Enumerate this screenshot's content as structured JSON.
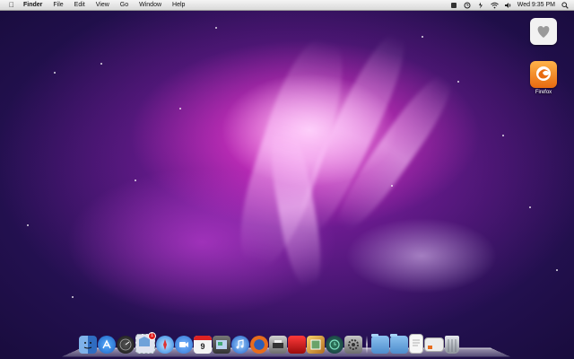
{
  "menubar": {
    "app_name": "Finder",
    "items": [
      "File",
      "Edit",
      "View",
      "Go",
      "Window",
      "Help"
    ],
    "clock": "Wed 9:35 PM",
    "status_icons": [
      "bluetooth-icon",
      "time-machine-icon",
      "battery-icon",
      "wifi-icon",
      "volume-icon"
    ],
    "spotlight_icon": "spotlight-search-icon"
  },
  "desktop": {
    "icons": [
      {
        "name": "heart-folder-icon",
        "label": ""
      },
      {
        "name": "firefox-icon",
        "label": "Firefox"
      }
    ]
  },
  "dock": {
    "apps": [
      {
        "name": "finder-icon",
        "color": "#4a86d6"
      },
      {
        "name": "app-store-icon",
        "color": "#2d7be0"
      },
      {
        "name": "dashboard-icon",
        "color": "#333333"
      },
      {
        "name": "mail-stamp-icon",
        "color": "#d8dbe8",
        "badge": "1"
      },
      {
        "name": "safari-icon",
        "color": "#3a8fe8"
      },
      {
        "name": "facetime-icon",
        "color": "#3e8be0"
      },
      {
        "name": "ical-icon",
        "color": "#f2f2f2",
        "date": "9"
      },
      {
        "name": "photo-booth-icon",
        "color": "#5a5a5a"
      },
      {
        "name": "itunes-icon",
        "color": "#2f6fd1"
      },
      {
        "name": "firefox-dock-icon",
        "color": "#e76c1d"
      },
      {
        "name": "printer-icon",
        "color": "#8c8c8c"
      },
      {
        "name": "photo-icon",
        "color": "#d42020"
      },
      {
        "name": "preview-icon",
        "color": "#c98a2c"
      },
      {
        "name": "time-machine-dock-icon",
        "color": "#2a5f7a"
      },
      {
        "name": "system-preferences-icon",
        "color": "#9a9a9a"
      }
    ],
    "stacks": [
      {
        "name": "applications-folder-icon",
        "color": "#6aa6dc"
      },
      {
        "name": "documents-folder-icon",
        "color": "#6aa6dc"
      },
      {
        "name": "document-stack-icon",
        "color": "#f4f4f4"
      },
      {
        "name": "downloads-stack-icon",
        "color": "#e8e8e8"
      },
      {
        "name": "trash-icon",
        "color": "#9aa0a8"
      }
    ]
  },
  "colors": {
    "wallpaper_magenta": "#e63dd0",
    "wallpaper_deep": "#3b1a7a"
  }
}
